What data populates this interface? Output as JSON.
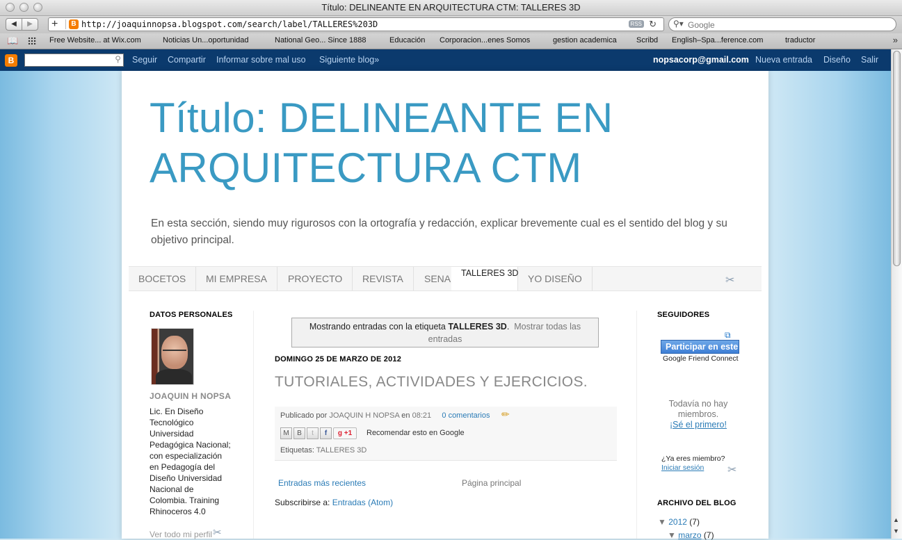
{
  "window": {
    "title": "Título: DELINEANTE EN ARQUITECTURA CTM: TALLERES 3D"
  },
  "toolbar": {
    "url": "http://joaquinnopsa.blogspot.com/search/label/TALLERES%203D",
    "rss_label": "RSS",
    "search_placeholder": "Google"
  },
  "bookmarks": [
    "Free Website... at Wix.com",
    "Noticias Un...oportunidad",
    "National Geo... Since 1888",
    "Educación",
    "Corporacion...enes Somos",
    "gestion academica",
    "Scribd",
    "English–Spa...ference.com",
    "traductor"
  ],
  "navbar": {
    "links": [
      "Seguir",
      "Compartir",
      "Informar sobre mal uso",
      "Siguiente blog»"
    ],
    "email": "nopsacorp@gmail.com",
    "right_links": [
      "Nueva entrada",
      "Diseño",
      "Salir"
    ]
  },
  "blog": {
    "title": "Título: DELINEANTE EN ARQUITECTURA CTM",
    "description": "En esta sección, siendo muy rigurosos con la ortografía y redacción, explicar brevemente cual es el sentido del blog y su objetivo principal."
  },
  "tabs": [
    {
      "label": "BOCETOS",
      "selected": false
    },
    {
      "label": "MI EMPRESA",
      "selected": false
    },
    {
      "label": "PROYECTO",
      "selected": false
    },
    {
      "label": "REVISTA",
      "selected": false
    },
    {
      "label": "SENA",
      "selected": false
    },
    {
      "label": "TALLERES 3D",
      "selected": true
    },
    {
      "label": "YO DISEÑO",
      "selected": false
    }
  ],
  "profile": {
    "heading": "DATOS PERSONALES",
    "name": "JOAQUIN H NOPSA",
    "bio": "Lic. En Diseño Tecnológico Universidad Pedagógica Nacional; con especialización en Pedagogía del Diseño Universidad Nacional de Colombia. Training Rhinoceros 4.0",
    "view_profile": "Ver todo mi perfil"
  },
  "main": {
    "label_notice_prefix": "Mostrando entradas con la etiqueta",
    "label_name": "TALLERES 3D",
    "show_all": "Mostrar todas las entradas",
    "post": {
      "date": "DOMINGO 25 DE MARZO DE 2012",
      "title": "TUTORIALES, ACTIVIDADES Y EJERCICIOS.",
      "published_by": "Publicado por",
      "author": "JOAQUIN H NOPSA",
      "at": "en",
      "time": "08:21",
      "comments": "0 comentarios",
      "plus_one": "+1",
      "recommend": "Recomendar esto en Google",
      "labels_prefix": "Etiquetas:",
      "label": "TALLERES 3D"
    },
    "newer": "Entradas más recientes",
    "home": "Página principal",
    "subscribe_prefix": "Subscribirse a:",
    "subscribe_link": "Entradas (Atom)"
  },
  "followers": {
    "heading": "SEGUIDORES",
    "join_button": "Participar en este sitio",
    "gfc": "Google Friend Connect",
    "no_members": "Todavía no hay miembros.",
    "be_first": "¡Sé el primero!",
    "already": "¿Ya eres miembro?",
    "sign_in": "Iniciar sesión"
  },
  "archive": {
    "heading": "ARCHIVO DEL BLOG",
    "year": "2012",
    "year_count": "(7)",
    "month": "marzo",
    "month_count": "(7)"
  },
  "colors": {
    "title_blue": "#3a9ac3",
    "navbar_bg": "#0b3a6d",
    "link_blue": "#2a7bb6",
    "blogger_orange": "#f57d00"
  },
  "icons": [
    "back-arrow-icon",
    "forward-arrow-icon",
    "add-bookmark-icon",
    "blogger-favicon-icon",
    "reload-icon",
    "search-magnifier-icon",
    "bookmarks-book-icon",
    "top-sites-grid-icon",
    "overflow-chevron-icon",
    "blogger-logo-icon",
    "wrench-screwdriver-icon",
    "pencil-edit-icon",
    "email-share-icon",
    "blogger-share-icon",
    "twitter-share-icon",
    "facebook-share-icon",
    "popup-window-icon",
    "triangle-down-icon"
  ]
}
